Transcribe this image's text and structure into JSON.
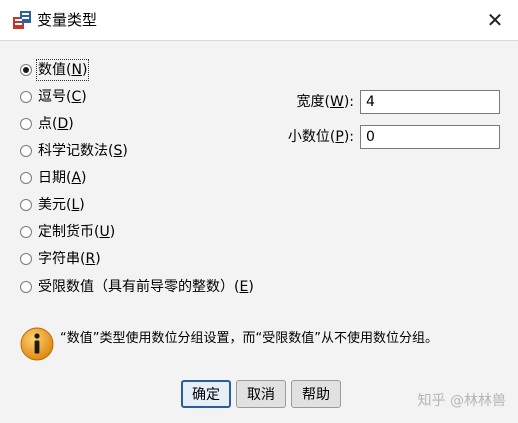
{
  "window": {
    "title": "变量类型",
    "close_glyph": "✕"
  },
  "types": [
    {
      "text": "数值(",
      "key": "N",
      "end": ")",
      "checked": true
    },
    {
      "text": "逗号(",
      "key": "C",
      "end": ")",
      "checked": false
    },
    {
      "text": "点(",
      "key": "D",
      "end": ")",
      "checked": false
    },
    {
      "text": "科学记数法(",
      "key": "S",
      "end": ")",
      "checked": false
    },
    {
      "text": "日期(",
      "key": "A",
      "end": ")",
      "checked": false
    },
    {
      "text": "美元(",
      "key": "L",
      "end": ")",
      "checked": false
    },
    {
      "text": "定制货币(",
      "key": "U",
      "end": ")",
      "checked": false
    },
    {
      "text": "字符串(",
      "key": "R",
      "end": ")",
      "checked": false
    },
    {
      "text": "受限数值（具有前导零的整数）(",
      "key": "E",
      "end": ")",
      "checked": false
    }
  ],
  "fields": {
    "width": {
      "label": "宽度(",
      "key": "W",
      "end": "):",
      "value": "4"
    },
    "decimals": {
      "label": "小数位(",
      "key": "P",
      "end": "):",
      "value": "0"
    }
  },
  "info": {
    "icon": "info-icon",
    "message": "“数值”类型使用数位分组设置，而“受限数值”从不使用数位分组。"
  },
  "buttons": {
    "ok": "确定",
    "cancel": "取消",
    "help": "帮助"
  },
  "watermark": "知乎 @林林兽",
  "colors": {
    "info_icon": "#f0a020",
    "default_button_border": "#2b5c9e"
  }
}
